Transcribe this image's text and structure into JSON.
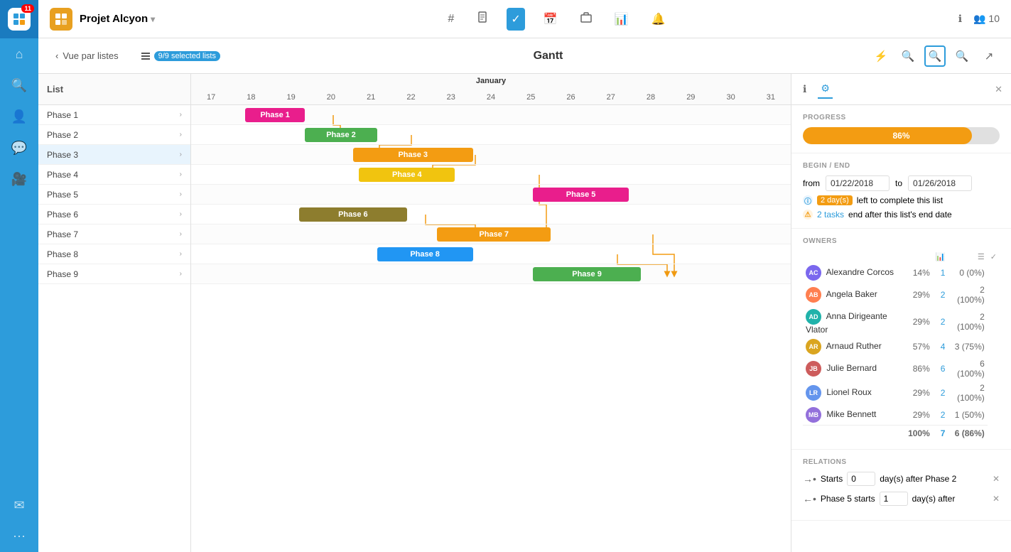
{
  "app": {
    "badge": "11",
    "project_title": "Projet Alcyon",
    "project_dropdown": true
  },
  "header": {
    "nav_icons": [
      "#",
      "doc",
      "check",
      "calendar",
      "briefcase",
      "chart",
      "bell",
      "info",
      "user-10"
    ],
    "active_nav": "check"
  },
  "sub_header": {
    "view_btn": "Vue par listes",
    "selected_label": "9/9 selected lists",
    "title": "Gantt",
    "actions": [
      "bolt",
      "search-zoom-out",
      "search",
      "search-zoom-in",
      "external-link"
    ]
  },
  "list": {
    "header": "List",
    "items": [
      {
        "label": "Phase 1",
        "selected": false
      },
      {
        "label": "Phase 2",
        "selected": false
      },
      {
        "label": "Phase 3",
        "selected": true
      },
      {
        "label": "Phase 4",
        "selected": false
      },
      {
        "label": "Phase 5",
        "selected": false
      },
      {
        "label": "Phase 6",
        "selected": false
      },
      {
        "label": "Phase 7",
        "selected": false
      },
      {
        "label": "Phase 8",
        "selected": false
      },
      {
        "label": "Phase 9",
        "selected": false
      }
    ]
  },
  "timeline": {
    "month": "January",
    "days": [
      17,
      18,
      19,
      20,
      21,
      22,
      23,
      24,
      25,
      26,
      27,
      28,
      29,
      30,
      31
    ]
  },
  "bars": [
    {
      "label": "Phase 1",
      "color": "#e91e8c",
      "left_pct": 9,
      "width_pct": 10,
      "row": 0
    },
    {
      "label": "Phase 2",
      "color": "#4caf50",
      "left_pct": 19,
      "width_pct": 12,
      "row": 1
    },
    {
      "label": "Phase 3",
      "color": "#f39c12",
      "left_pct": 27,
      "width_pct": 20,
      "row": 2
    },
    {
      "label": "Phase 4",
      "color": "#f1c40f",
      "left_pct": 28,
      "width_pct": 16,
      "row": 3
    },
    {
      "label": "Phase 5",
      "color": "#e91e8c",
      "left_pct": 57,
      "width_pct": 16,
      "row": 4
    },
    {
      "label": "Phase 6",
      "color": "#8d7d2e",
      "left_pct": 18,
      "width_pct": 18,
      "row": 5
    },
    {
      "label": "Phase 7",
      "color": "#f39c12",
      "left_pct": 41,
      "width_pct": 19,
      "row": 6
    },
    {
      "label": "Phase 8",
      "color": "#2196f3",
      "left_pct": 31,
      "width_pct": 16,
      "row": 7
    },
    {
      "label": "Phase 9",
      "color": "#4caf50",
      "left_pct": 57,
      "width_pct": 18,
      "row": 8
    }
  ],
  "right_panel": {
    "tabs": [
      "info",
      "settings"
    ],
    "active_tab": "settings",
    "progress": {
      "title": "PROGRESS",
      "value": 86,
      "label": "86%",
      "color": "#f39c12"
    },
    "begin_end": {
      "title": "BEGIN / END",
      "from_label": "from",
      "from_value": "01/22/2018",
      "to_label": "to",
      "to_value": "01/26/2018",
      "days_remaining": "2 day(s) left to complete this list",
      "tasks_warning": "2 tasks end after this list's end date"
    },
    "owners": {
      "title": "OWNERS",
      "col_chart": "📊",
      "col_list": "☰",
      "col_check": "✓",
      "items": [
        {
          "name": "Alexandre Corcos",
          "pct": "14%",
          "tasks": "1",
          "done": "0 (0%)",
          "color": "#7b68ee"
        },
        {
          "name": "Angela Baker",
          "pct": "29%",
          "tasks": "2",
          "done": "2 (100%)",
          "color": "#ff7f50"
        },
        {
          "name": "Anna Dirigeante Vlator",
          "pct": "29%",
          "tasks": "2",
          "done": "2 (100%)",
          "color": "#20b2aa"
        },
        {
          "name": "Arnaud Ruther",
          "pct": "57%",
          "tasks": "4",
          "done": "3 (75%)",
          "color": "#daa520"
        },
        {
          "name": "Julie Bernard",
          "pct": "86%",
          "tasks": "6",
          "done": "6 (100%)",
          "color": "#cd5c5c"
        },
        {
          "name": "Lionel Roux",
          "pct": "29%",
          "tasks": "2",
          "done": "2 (100%)",
          "color": "#6495ed"
        },
        {
          "name": "Mike Bennett",
          "pct": "29%",
          "tasks": "2",
          "done": "1 (50%)",
          "color": "#9370db"
        }
      ],
      "total_pct": "100%",
      "total_tasks": "7",
      "total_done": "6 (86%)"
    },
    "relations": {
      "title": "RELATIONS",
      "items": [
        {
          "arrow": "→",
          "label": "Starts",
          "value": "0",
          "suffix": "day(s) after Phase 2"
        },
        {
          "arrow": "←",
          "label": "Phase 5 starts",
          "value": "1",
          "suffix": "day(s) after"
        }
      ]
    }
  }
}
